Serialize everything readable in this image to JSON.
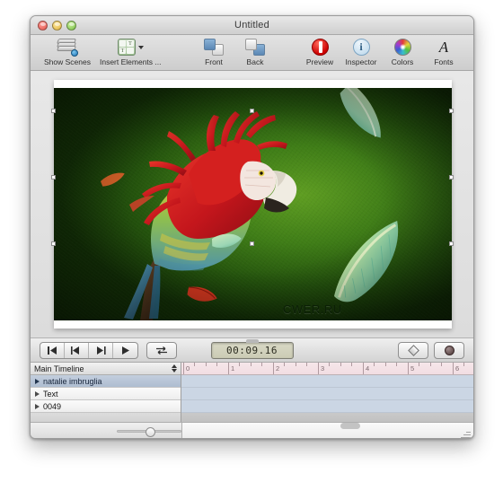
{
  "window": {
    "title": "Untitled",
    "controls": {
      "close": "close",
      "minimize": "minimize",
      "zoom": "zoom"
    }
  },
  "toolbar": {
    "left_items": [
      {
        "label": "Show Scenes",
        "icon": "scenes-stack-icon"
      },
      {
        "label": "Insert Elements ...",
        "icon": "insert-elements-grid-icon"
      }
    ],
    "right_items": [
      {
        "label": "Front",
        "icon": "bring-front-icon"
      },
      {
        "label": "Back",
        "icon": "send-back-icon"
      },
      {
        "label": "Preview",
        "icon": "preview-record-icon"
      },
      {
        "label": "Inspector",
        "icon": "inspector-info-icon"
      },
      {
        "label": "Colors",
        "icon": "colors-wheel-icon"
      },
      {
        "label": "Fonts",
        "icon": "fonts-a-icon"
      }
    ],
    "element_grid_letters": [
      "",
      "T",
      "T",
      ""
    ]
  },
  "canvas": {
    "watermark": "CWER.RU",
    "scene_description": "scarlet macaw parrot on textured green background with floating feathers",
    "handles": 8
  },
  "transport": {
    "buttons": [
      {
        "name": "go-to-start",
        "glyph": "start"
      },
      {
        "name": "step-backward",
        "glyph": "step-back"
      },
      {
        "name": "step-forward",
        "glyph": "step-fwd"
      },
      {
        "name": "play",
        "glyph": "play"
      }
    ],
    "loop_label": "loop",
    "timecode": "00:09.16",
    "keyframe_button": "add-keyframe",
    "record_button": "record"
  },
  "timeline": {
    "header": "Main Timeline",
    "tracks": [
      {
        "name": "natalie imbruglia",
        "selected": true
      },
      {
        "name": "Text",
        "selected": false
      },
      {
        "name": "0049",
        "selected": false
      }
    ],
    "ruler_ticks": [
      "0",
      "1",
      "2",
      "3",
      "4",
      "5",
      "6"
    ]
  },
  "colors": {
    "accent_selected_track": "#aebdd1",
    "ruler_tint": "#f2dde2",
    "record_red": "#cc0000",
    "canvas_green": "#3f7d17"
  }
}
